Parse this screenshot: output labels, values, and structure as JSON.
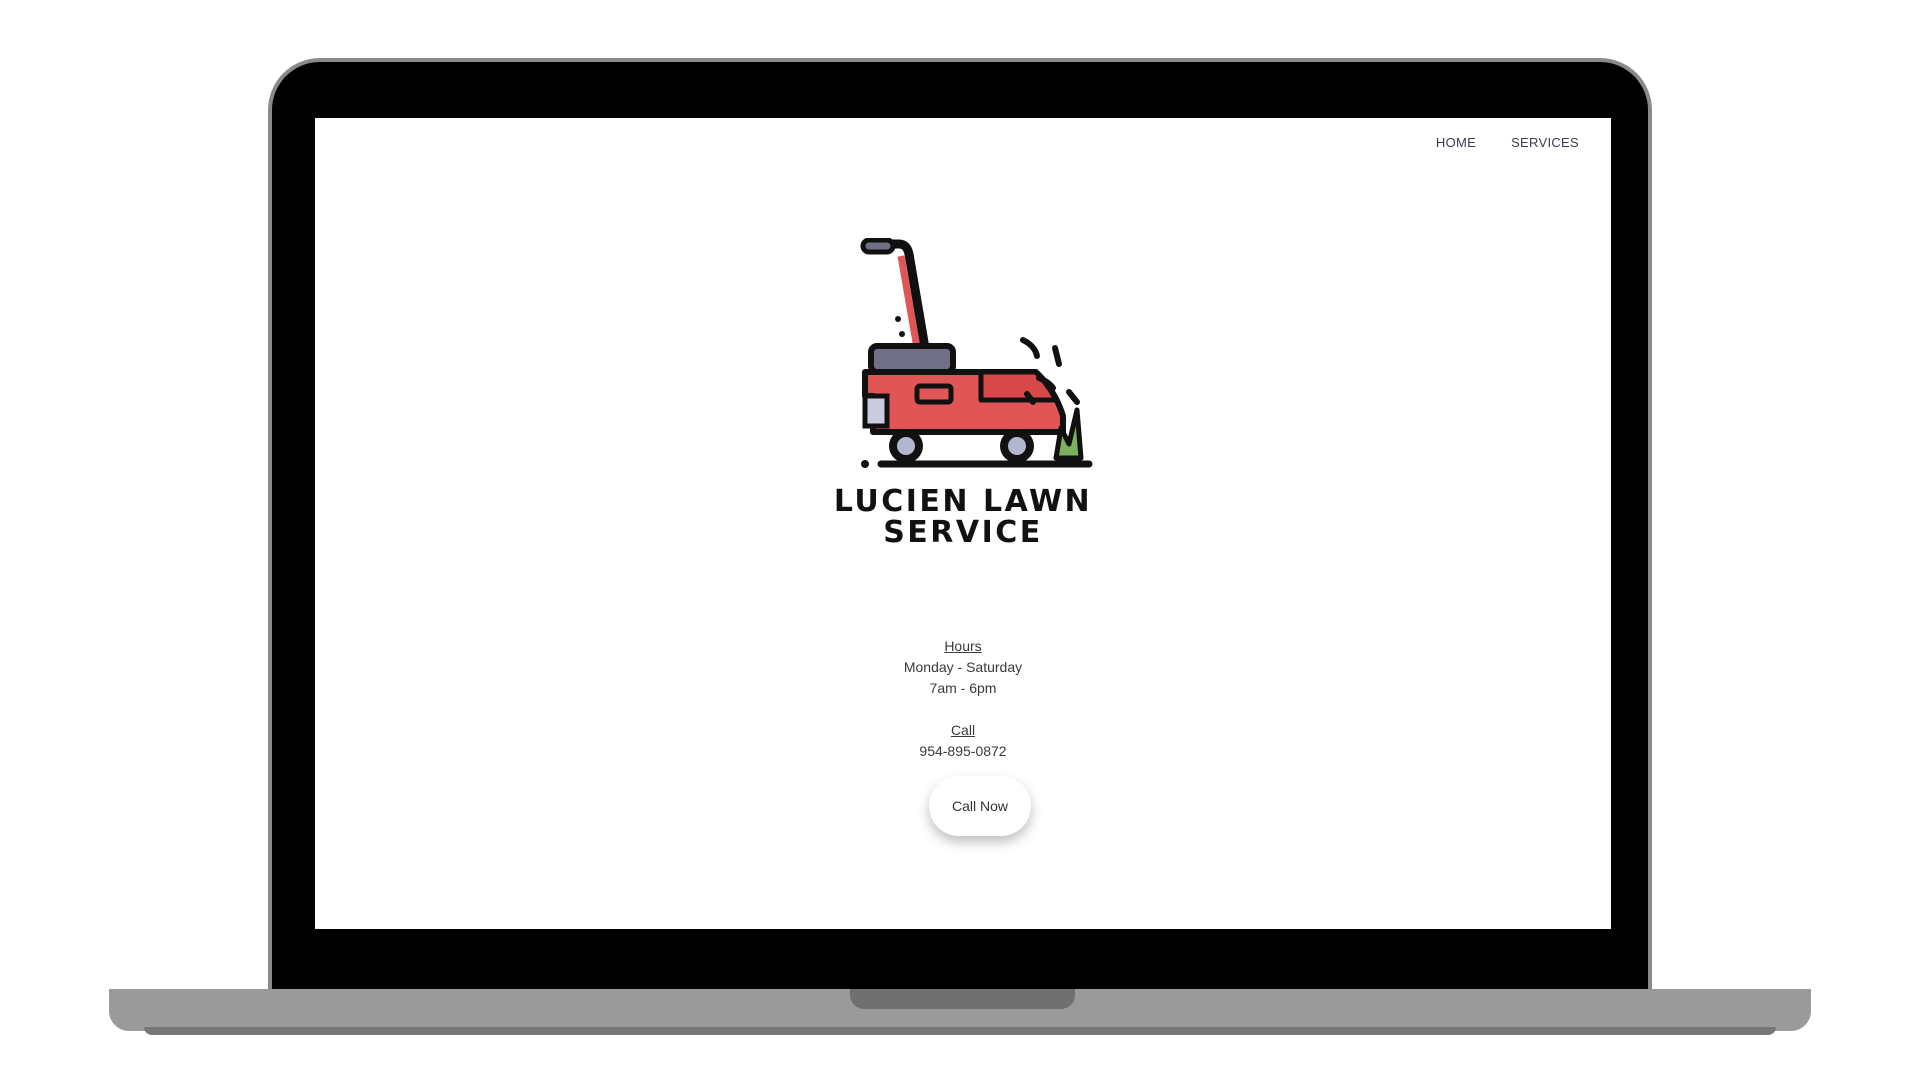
{
  "nav": {
    "home_label": "HOME",
    "services_label": "SERVICES"
  },
  "logo": {
    "line1": "LUCIEN LAWN",
    "line2": "SERVICE"
  },
  "hours": {
    "heading": "Hours",
    "days": "Monday - Saturday",
    "times": "7am - 6pm"
  },
  "call": {
    "heading": "Call",
    "phone": "954-895-0872",
    "button_label": "Call Now"
  },
  "colors": {
    "mower_red": "#e05555",
    "mower_gray": "#6f6f86",
    "grass_green": "#7bb15a",
    "text": "#3a3a3a"
  }
}
